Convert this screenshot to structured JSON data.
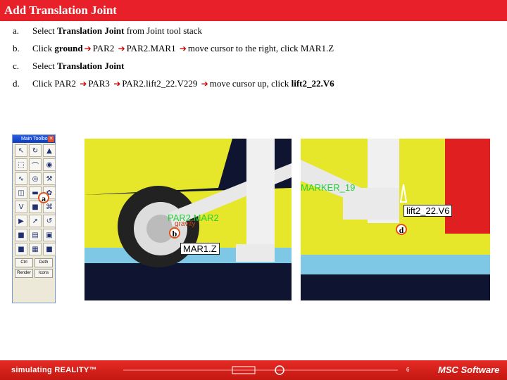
{
  "header": {
    "title": "Add Translation Joint"
  },
  "steps": [
    {
      "label": "a.",
      "parts": [
        {
          "t": "Select "
        },
        {
          "t": "Translation Joint",
          "b": true
        },
        {
          "t": " from Joint tool stack"
        }
      ]
    },
    {
      "label": "b.",
      "parts": [
        {
          "t": "Click "
        },
        {
          "t": "ground",
          "b": true
        },
        {
          "a": true
        },
        {
          "t": "PAR2 "
        },
        {
          "a": true
        },
        {
          "t": "PAR2.MAR1 "
        },
        {
          "a": true
        },
        {
          "t": "move cursor to the right, click MAR1.Z"
        }
      ]
    },
    {
      "label": "c.",
      "parts": [
        {
          "t": "Select "
        },
        {
          "t": "Translation Joint",
          "b": true
        }
      ]
    },
    {
      "label": "d.",
      "parts": [
        {
          "t": "Click PAR2 "
        },
        {
          "a": true
        },
        {
          "t": "PAR3 "
        },
        {
          "a": true
        },
        {
          "t": "PAR2.lift2_22.V229 "
        },
        {
          "a": true
        },
        {
          "t": "move cursor up, click "
        },
        {
          "t": "lift2_22.V6",
          "b": true
        }
      ]
    }
  ],
  "arrow_glyph": "➔",
  "toolbox": {
    "title": "Main Toolbox",
    "close_glyph": "✕",
    "icons": [
      "cursor-icon",
      "rotate-icon",
      "marker-icon",
      "view-icon",
      "link-icon",
      "joint-icon",
      "spline-icon",
      "torus-icon",
      "bolt-icon",
      "graph-icon",
      "trans-joint-icon",
      "palette-icon",
      "view-c-icon",
      "fixed-joint-icon",
      "geom-icon",
      "sim-icon",
      "force-icon",
      "ref-c-icon",
      "box-icon",
      "part-icon",
      "cylinder-icon",
      "black-icon",
      "grid-icon",
      "blue-icon"
    ],
    "glyphs": [
      "↖",
      "↻",
      "▲",
      "⬚",
      "⌒",
      "◉",
      "∿",
      "◎",
      "⚒",
      "◫",
      "▬",
      "✿",
      "V",
      "■",
      "⌘",
      "▶",
      "➚",
      "↺",
      "■",
      "▤",
      "▣",
      "■",
      "▦",
      "■"
    ],
    "buttons": [
      [
        "Ctrl",
        "Deth"
      ],
      [
        "Render",
        "Icons"
      ]
    ]
  },
  "markers": {
    "a": "a",
    "b": "b",
    "d": "d"
  },
  "view1": {
    "labels": {
      "green": "PAR2.MAR2",
      "gravity": "gravity",
      "mar": "MAR1.Z"
    }
  },
  "view2": {
    "labels": {
      "green": "MARKER_19",
      "box": "lift2_22.V6"
    }
  },
  "footer": {
    "brand": "simulating REALITY™",
    "page": "6",
    "company": "MSC Software"
  },
  "colors": {
    "accent": "#e8202a",
    "scene_yellow": "#e6e62a",
    "scene_sky": "#7ec8e6",
    "scene_red": "#e02020",
    "label_green": "#23d03a",
    "marker_orange": "#e0531a"
  }
}
